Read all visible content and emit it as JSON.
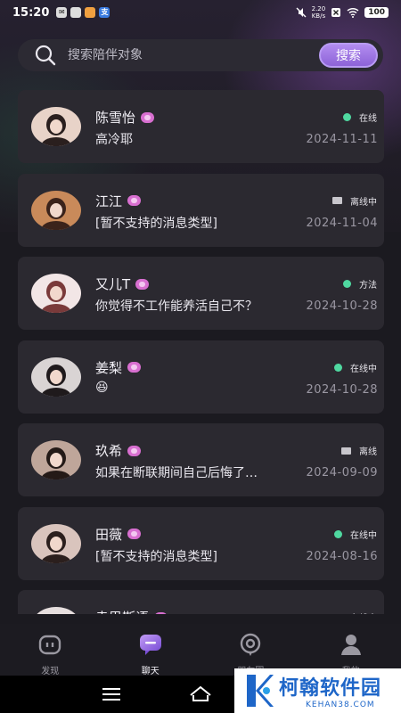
{
  "status_bar": {
    "time": "15:20",
    "net_speed_top": "2.20",
    "net_speed_bottom": "KB/s",
    "battery": "100",
    "app_icons": [
      "mail-icon",
      "app-icon",
      "app-icon",
      "alipay-icon"
    ]
  },
  "search": {
    "placeholder": "搜索陪伴对象",
    "button_label": "搜索"
  },
  "chats": [
    {
      "name": "陈雪怡",
      "message": "高冷耶",
      "status": "在线",
      "status_type": "online",
      "date": "2024-11-11",
      "avatar_colors": [
        "#e8d3c8",
        "#2a1f1e"
      ]
    },
    {
      "name": "江江",
      "message": "[暂不支持的消息类型]",
      "status": "离线中",
      "status_type": "offline",
      "date": "2024-11-04",
      "avatar_colors": [
        "#c98a5a",
        "#3b231b"
      ]
    },
    {
      "name": "又儿T",
      "message": "你觉得不工作能养活自己不？",
      "status": "方法",
      "status_type": "online",
      "date": "2024-10-28",
      "avatar_colors": [
        "#f2e6e6",
        "#7a3a3a"
      ]
    },
    {
      "name": "姜梨",
      "message": "😆",
      "status": "在线中",
      "status_type": "online",
      "date": "2024-10-28",
      "avatar_colors": [
        "#d9d4d4",
        "#1f1a1c"
      ]
    },
    {
      "name": "玖希",
      "message": "如果在断联期间自己后悔了…",
      "status": "离线",
      "status_type": "offline",
      "date": "2024-09-09",
      "avatar_colors": [
        "#bfa69a",
        "#241a17"
      ]
    },
    {
      "name": "田薇",
      "message": "[暂不支持的消息类型]",
      "status": "在线中",
      "status_type": "online",
      "date": "2024-08-16",
      "avatar_colors": [
        "#d9c4bd",
        "#2b1f1d"
      ]
    },
    {
      "name": "幸思斯语",
      "message": "",
      "status": "在线中",
      "status_type": "offline",
      "date": "",
      "avatar_colors": [
        "#e6dede",
        "#2a2222"
      ]
    }
  ],
  "tabs": [
    {
      "label": "发现",
      "icon": "discover-icon"
    },
    {
      "label": "聊天",
      "icon": "chat-icon"
    },
    {
      "label": "朋友圈",
      "icon": "moments-icon"
    },
    {
      "label": "我的",
      "icon": "profile-icon"
    }
  ],
  "active_tab": "聊天",
  "watermark": {
    "title": "柯翰软件园",
    "subtitle": "KEHAN38.COM"
  },
  "colors": {
    "accent": "#9b73e3",
    "online": "#4fd8a0",
    "card": "#2b2930"
  }
}
